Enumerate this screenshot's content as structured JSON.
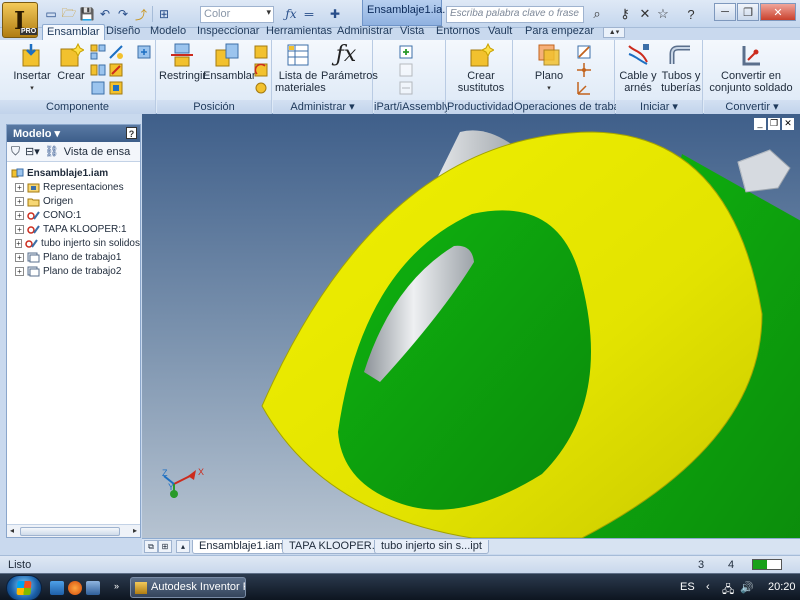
{
  "app": {
    "badge": "PRO",
    "document_title": "Ensamblaje1.ia...",
    "color_placeholder": "Color",
    "search_placeholder": "Escriba palabra clave o frase"
  },
  "ribbon_tabs": [
    "Ensamblar",
    "Diseño",
    "Modelo",
    "Inspeccionar",
    "Herramientas",
    "Administrar",
    "Vista",
    "Entornos",
    "Vault",
    "Para empezar"
  ],
  "ribbon_panels": {
    "componente": {
      "label": "Componente",
      "insert": "Insertar",
      "create": "Crear"
    },
    "posicion": {
      "label": "Posición",
      "restrict": "Restringir",
      "assemble": "Ensamblar"
    },
    "administrar": {
      "label": "Administrar",
      "bom_line1": "Lista de",
      "bom_line2": "materiales",
      "params": "Parámetros"
    },
    "ipart": {
      "label": "iPart/iAssembly"
    },
    "productividad": {
      "label": "Productividad",
      "subst_line1": "Crear",
      "subst_line2": "sustitutos"
    },
    "operaciones": {
      "label": "Operaciones de trabajo",
      "plane": "Plano"
    },
    "iniciar": {
      "label": "Iniciar",
      "cable_line1": "Cable y",
      "cable_line2": "arnés",
      "tubes_line1": "Tubos y",
      "tubes_line2": "tuberías"
    },
    "convertir": {
      "label": "Convertir",
      "convert_line1": "Convertir en",
      "convert_line2": "conjunto soldado"
    }
  },
  "browser": {
    "title": "Modelo",
    "help": "?",
    "view_label": "Vista de ensa",
    "tree": [
      {
        "label": "Ensamblaje1.iam",
        "kind": "root",
        "bold": true
      },
      {
        "label": "Representaciones",
        "kind": "folder-rep"
      },
      {
        "label": "Origen",
        "kind": "folder"
      },
      {
        "label": "CONO:1",
        "kind": "part"
      },
      {
        "label": "TAPA KLOOPER:1",
        "kind": "part"
      },
      {
        "label": "tubo injerto  sin solidos",
        "kind": "part"
      },
      {
        "label": "Plano de trabajo1",
        "kind": "plane"
      },
      {
        "label": "Plano de trabajo2",
        "kind": "plane"
      }
    ]
  },
  "viewport": {
    "colors": {
      "yellow": "#e6e600",
      "green": "#0d9d0d",
      "silver": "#bfc3c7"
    },
    "triad_labels": {
      "x": "X",
      "y": "Y",
      "z": "Z"
    }
  },
  "doc_tabs": [
    "Ensamblaje1.iam",
    "TAPA KLOOPER.ipt",
    "tubo injerto  sin s...ipt"
  ],
  "status": {
    "text": "Listo",
    "num1": "3",
    "num2": "4",
    "progress": 0.5
  },
  "taskbar": {
    "app_label": "Autodesk Inventor P...",
    "lang": "ES",
    "time": "20:20"
  }
}
